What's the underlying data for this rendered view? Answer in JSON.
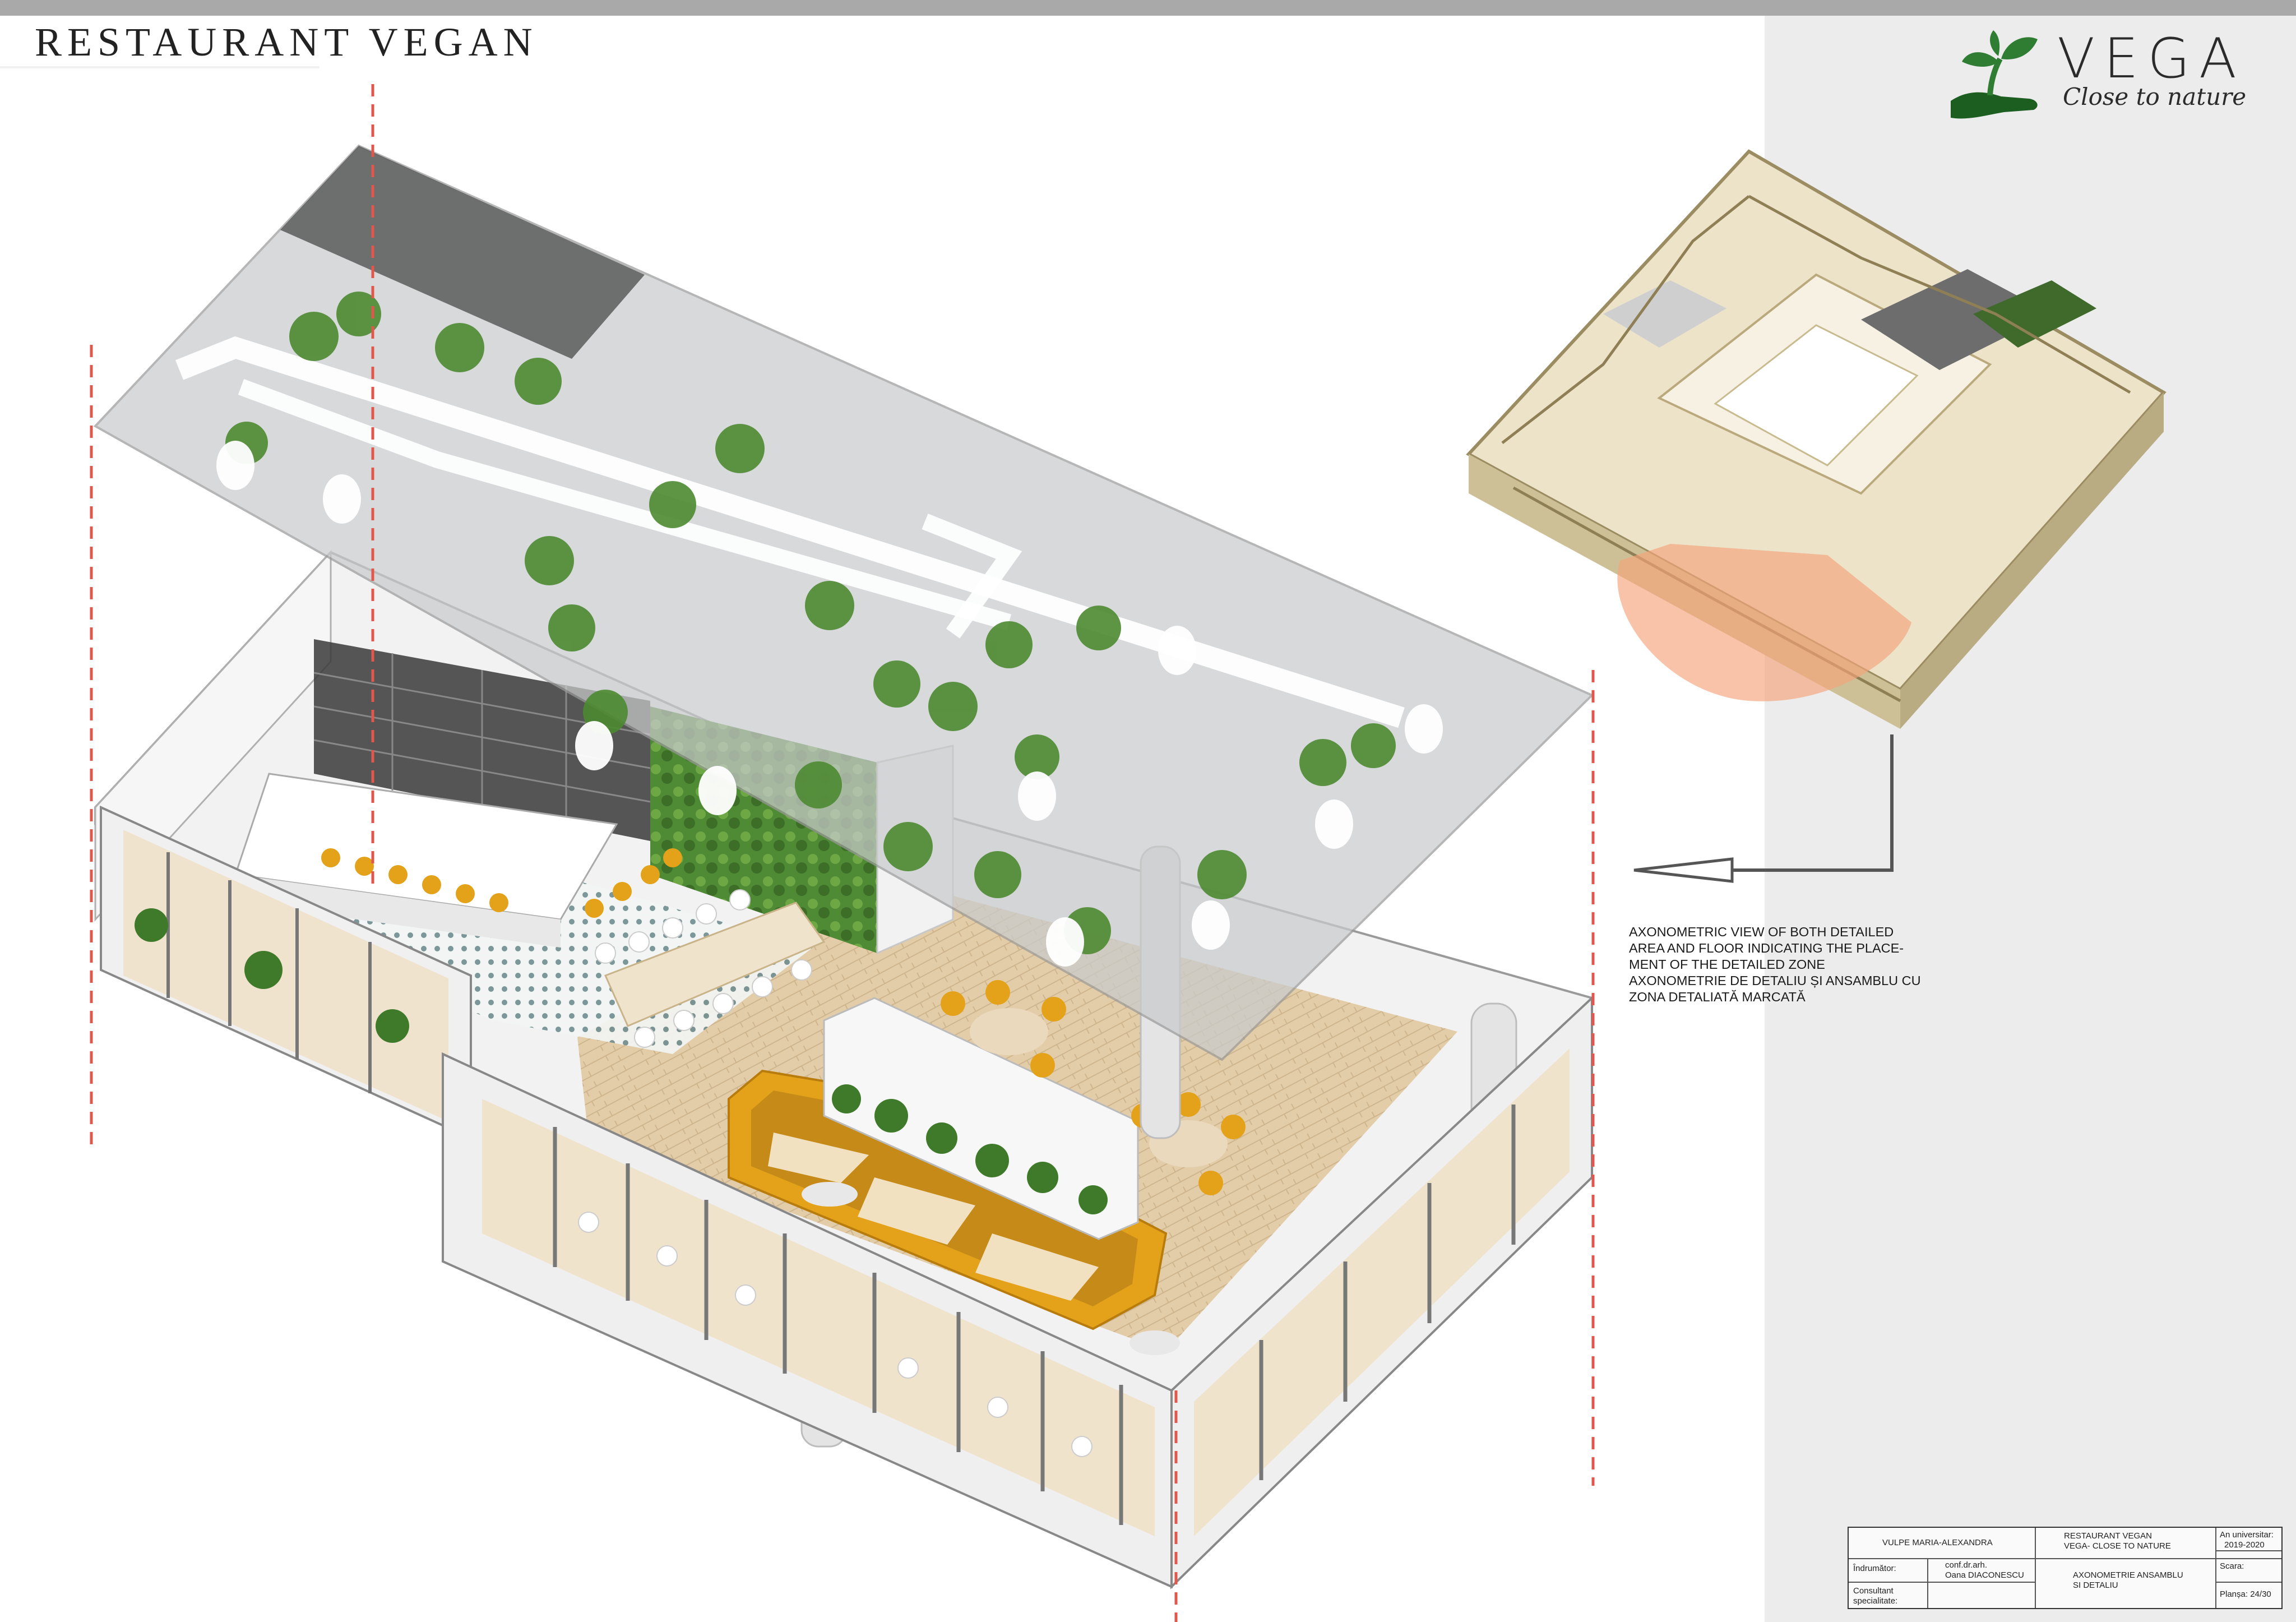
{
  "page_title": "RESTAURANT VEGAN",
  "logo": {
    "wordmark": "VEGA",
    "tagline": "Close to nature",
    "colors": {
      "leaf": "#2e7d32",
      "hand": "#1b5e20"
    }
  },
  "caption_lines": [
    "AXONOMETRIC VIEW OF BOTH  DETAILED",
    "AREA AND FLOOR INDICATING THE PLACE-",
    "MENT OF THE DETAILED ZONE",
    "AXONOMETRIE DE DETALIU ȘI ANSAMBLU CU",
    "ZONA DETALIATĂ MARCATĂ"
  ],
  "title_block": {
    "author": "VULPE MARIA-ALEXANDRA",
    "project_line1": "RESTAURANT VEGAN",
    "project_line2": "VEGA- CLOSE TO NATURE",
    "year_label": "An universitar:",
    "year_value": "2019-2020",
    "tutor_label": "Îndrumător:",
    "tutor_title": "conf.dr.arh.",
    "tutor_name": "Oana DIACONESCU",
    "sheet_title_line1": "AXONOMETRIE ANSAMBLU",
    "sheet_title_line2": "SI DETALIU",
    "scale_label": "Scara:",
    "consultant_label_line1": "Consultant",
    "consultant_label_line2": "specialitate:",
    "sheet_label": "Planșa:",
    "sheet_value": "24/30"
  },
  "colors": {
    "cut_line": "#e2574c",
    "ceiling": "#c9cbcc",
    "floor_wood": "#e0c9a3",
    "seating_yellow": "#e3a21a",
    "green_wall": "#4a7d32",
    "highlight_zone": "#f4a37a",
    "side_panel": "#ececec"
  }
}
